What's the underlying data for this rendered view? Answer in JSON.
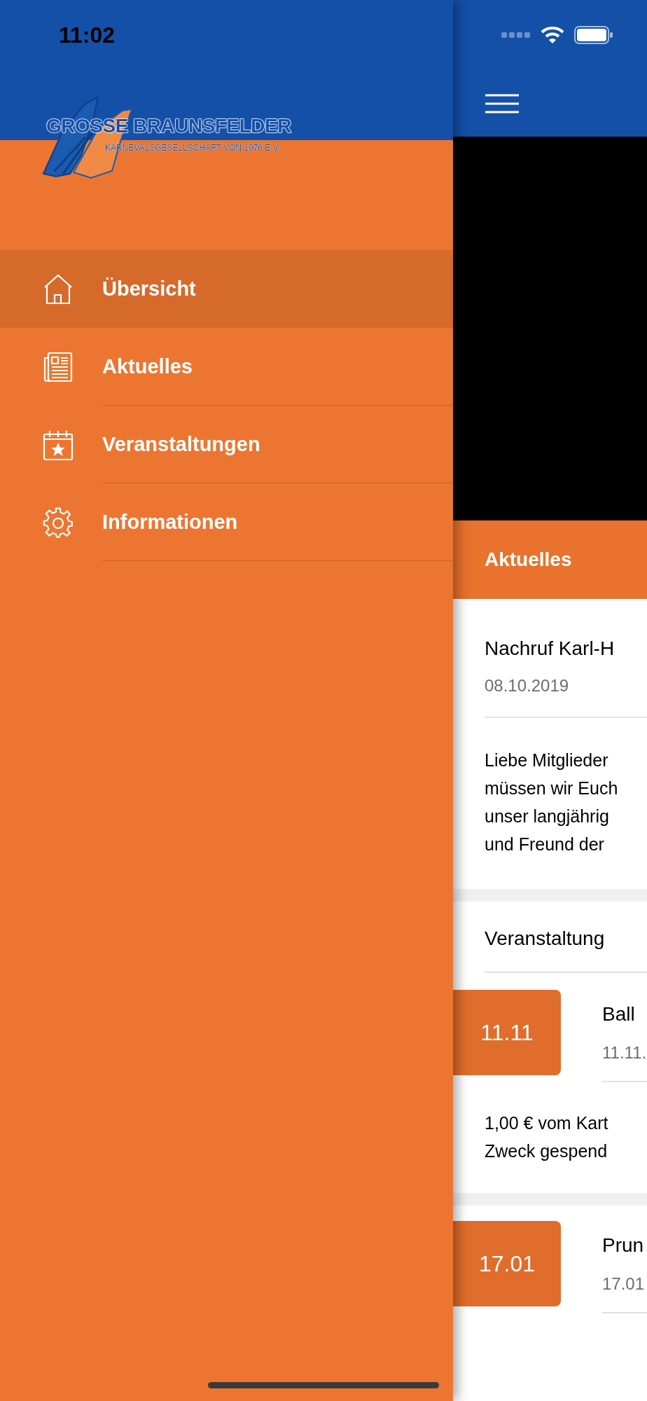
{
  "status_bar": {
    "time": "11:02"
  },
  "logo": {
    "title": "GROSSE BRAUNSFELDER",
    "subtitle": "KARNEVALSGESELLSCHAFT VON 1976 E.V."
  },
  "menu": [
    {
      "label": "Übersicht",
      "kind": "home",
      "selected": true
    },
    {
      "label": "Aktuelles",
      "kind": "news",
      "selected": false
    },
    {
      "label": "Veranstaltungen",
      "kind": "calendar",
      "selected": false
    },
    {
      "label": "Informationen",
      "kind": "gear",
      "selected": false
    }
  ],
  "content": {
    "section_title": "Aktuelles",
    "news": {
      "title": "Nachruf Karl-H",
      "date": "08.10.2019",
      "text": "Liebe Mitglieder\nmüssen wir Euch\nunser langjährig\nund Freund der"
    },
    "events_title": "Veranstaltung",
    "events": [
      {
        "badge": "11.11",
        "title": "Ball",
        "date": "11.11.",
        "text": "1,00 € vom Kart\nZweck gespend"
      },
      {
        "badge": "17.01",
        "title": "Prun",
        "date": "17.01"
      }
    ]
  }
}
